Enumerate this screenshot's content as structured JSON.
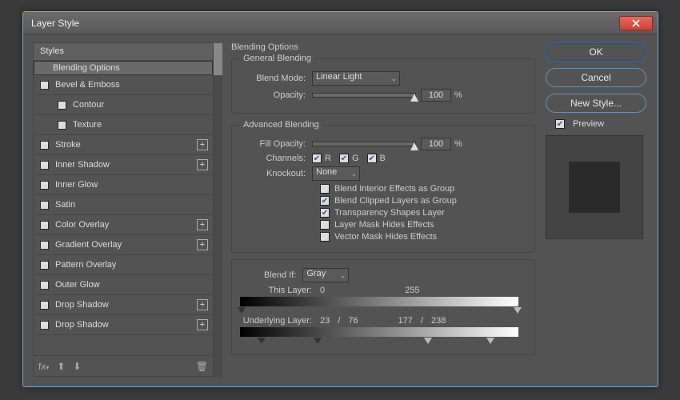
{
  "window": {
    "title": "Layer Style"
  },
  "styles_header": "Styles",
  "styles": [
    {
      "label": "Blending Options",
      "checkbox": false,
      "selected": true,
      "indent": 0,
      "plus": false
    },
    {
      "label": "Bevel & Emboss",
      "checkbox": true,
      "checked": false,
      "indent": 0,
      "plus": false
    },
    {
      "label": "Contour",
      "checkbox": true,
      "checked": false,
      "indent": 1,
      "plus": false
    },
    {
      "label": "Texture",
      "checkbox": true,
      "checked": false,
      "indent": 1,
      "plus": false
    },
    {
      "label": "Stroke",
      "checkbox": true,
      "checked": false,
      "indent": 0,
      "plus": true
    },
    {
      "label": "Inner Shadow",
      "checkbox": true,
      "checked": false,
      "indent": 0,
      "plus": true
    },
    {
      "label": "Inner Glow",
      "checkbox": true,
      "checked": false,
      "indent": 0,
      "plus": false
    },
    {
      "label": "Satin",
      "checkbox": true,
      "checked": false,
      "indent": 0,
      "plus": false
    },
    {
      "label": "Color Overlay",
      "checkbox": true,
      "checked": false,
      "indent": 0,
      "plus": true
    },
    {
      "label": "Gradient Overlay",
      "checkbox": true,
      "checked": false,
      "indent": 0,
      "plus": true
    },
    {
      "label": "Pattern Overlay",
      "checkbox": true,
      "checked": false,
      "indent": 0,
      "plus": false
    },
    {
      "label": "Outer Glow",
      "checkbox": true,
      "checked": false,
      "indent": 0,
      "plus": false
    },
    {
      "label": "Drop Shadow",
      "checkbox": true,
      "checked": false,
      "indent": 0,
      "plus": true
    },
    {
      "label": "Drop Shadow",
      "checkbox": true,
      "checked": false,
      "indent": 0,
      "plus": true
    }
  ],
  "blending": {
    "section_title": "Blending Options",
    "general_title": "General Blending",
    "blend_mode_label": "Blend Mode:",
    "blend_mode_value": "Linear Light",
    "opacity_label": "Opacity:",
    "opacity_value": "100",
    "percent": "%",
    "advanced_title": "Advanced Blending",
    "fill_opacity_label": "Fill Opacity:",
    "fill_opacity_value": "100",
    "channels_label": "Channels:",
    "ch_r": "R",
    "ch_g": "G",
    "ch_b": "B",
    "knockout_label": "Knockout:",
    "knockout_value": "None",
    "opt_interior": "Blend Interior Effects as Group",
    "opt_clipped": "Blend Clipped Layers as Group",
    "opt_transparency": "Transparency Shapes Layer",
    "opt_layermask": "Layer Mask Hides Effects",
    "opt_vectormask": "Vector Mask Hides Effects",
    "blendif_label": "Blend If:",
    "blendif_value": "Gray",
    "this_layer_label": "This Layer:",
    "this_vals": [
      "0",
      "255"
    ],
    "underlying_label": "Underlying Layer:",
    "under_vals": [
      "23",
      "/",
      "76",
      "177",
      "/",
      "238"
    ]
  },
  "buttons": {
    "ok": "OK",
    "cancel": "Cancel",
    "new_style": "New Style...",
    "preview": "Preview"
  },
  "footer_fx": "fx"
}
